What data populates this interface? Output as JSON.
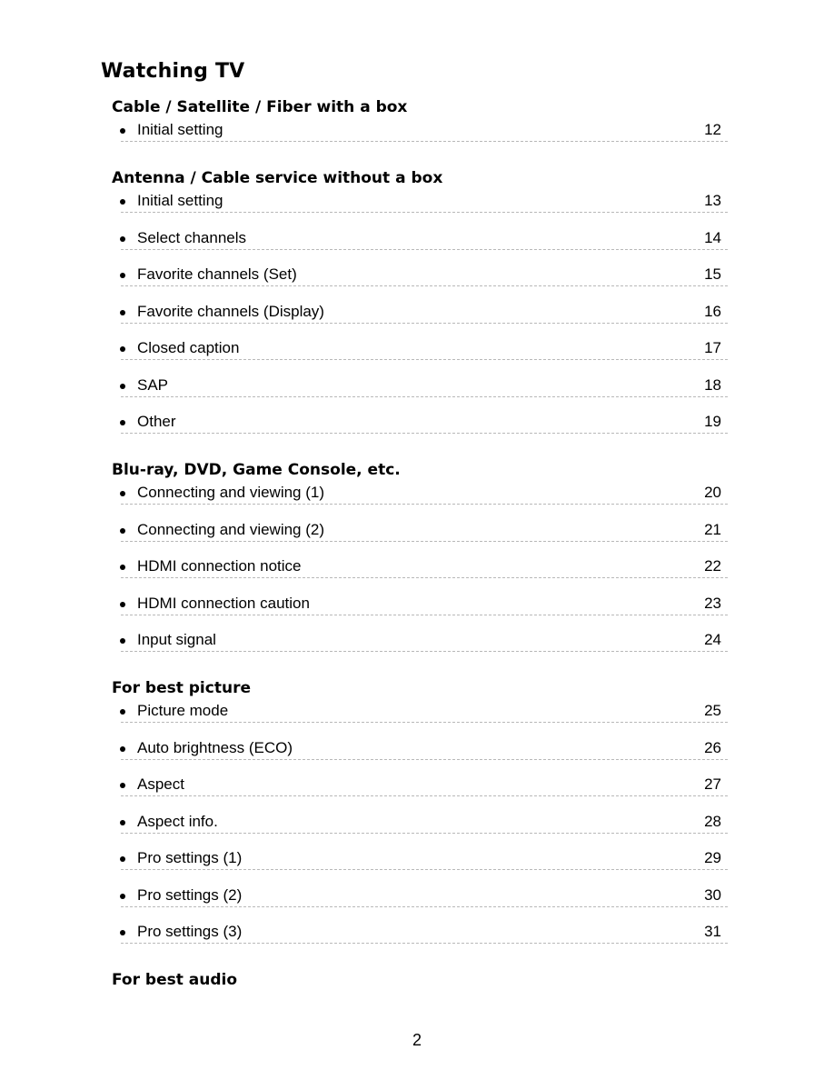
{
  "title": "Watching TV",
  "sections": [
    {
      "title": "Cable / Satellite / Fiber with a box",
      "items": [
        {
          "label": "Initial setting",
          "page": "12"
        }
      ]
    },
    {
      "title": "Antenna / Cable service without a box",
      "items": [
        {
          "label": "Initial setting",
          "page": "13"
        },
        {
          "label": "Select channels",
          "page": "14"
        },
        {
          "label": "Favorite channels (Set)",
          "page": "15"
        },
        {
          "label": "Favorite channels (Display)",
          "page": "16"
        },
        {
          "label": "Closed caption",
          "page": "17"
        },
        {
          "label": "SAP",
          "page": "18"
        },
        {
          "label": "Other",
          "page": "19"
        }
      ]
    },
    {
      "title": "Blu-ray, DVD, Game Console, etc.",
      "items": [
        {
          "label": "Connecting and viewing (1)",
          "page": "20"
        },
        {
          "label": "Connecting and viewing (2)",
          "page": "21"
        },
        {
          "label": "HDMI connection notice",
          "page": "22"
        },
        {
          "label": "HDMI connection caution",
          "page": "23"
        },
        {
          "label": "Input signal",
          "page": "24"
        }
      ]
    },
    {
      "title": "For best picture",
      "items": [
        {
          "label": "Picture mode",
          "page": "25"
        },
        {
          "label": "Auto brightness (ECO)",
          "page": "26"
        },
        {
          "label": "Aspect",
          "page": "27"
        },
        {
          "label": "Aspect info.",
          "page": "28"
        },
        {
          "label": "Pro settings (1)",
          "page": "29"
        },
        {
          "label": "Pro settings (2)",
          "page": "30"
        },
        {
          "label": "Pro settings (3)",
          "page": "31"
        }
      ]
    },
    {
      "title": "For best audio",
      "items": []
    }
  ],
  "footer": {
    "page_number": "2"
  }
}
